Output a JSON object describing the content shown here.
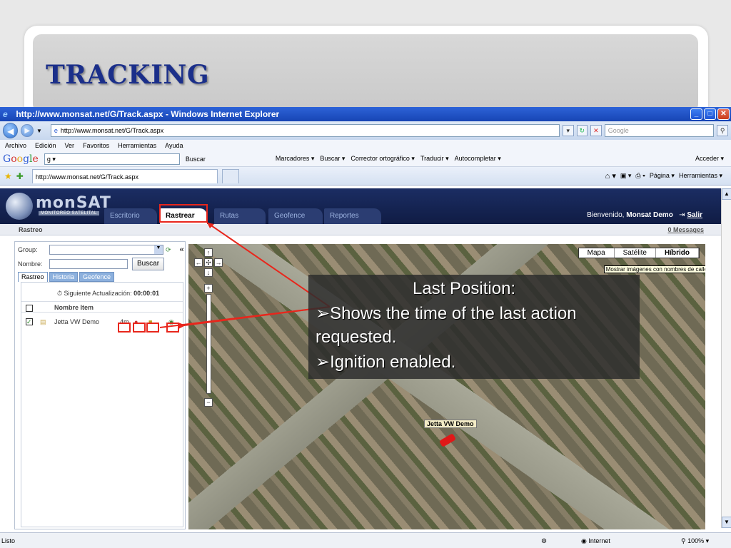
{
  "slide": {
    "title": "TRACKING"
  },
  "browser": {
    "window_title": "http://www.monsat.net/G/Track.aspx - Windows Internet Explorer",
    "url": "http://www.monsat.net/G/Track.aspx",
    "search_placeholder": "Google",
    "menu": [
      "Archivo",
      "Edición",
      "Ver",
      "Favoritos",
      "Herramientas",
      "Ayuda"
    ],
    "google_toolbar": {
      "search_value": "g ▾",
      "buttons": [
        "Buscar",
        "Marcadores ▾",
        "Buscar ▾",
        "Corrector ortográfico ▾",
        "Traducir ▾",
        "Autocompletar ▾",
        "Acceder ▾"
      ]
    },
    "tab_title": "http://www.monsat.net/G/Track.aspx",
    "tab_tools": [
      "Página ▾",
      "Herramientas ▾"
    ],
    "status": "Listo",
    "zone": "Internet",
    "zoom": "100%"
  },
  "app": {
    "logo_text": "monSAT",
    "logo_sub": "MONITOREO SATELITAL",
    "tabs": [
      "Escritorio",
      "Rastrear",
      "Rutas",
      "Geofence",
      "Reportes"
    ],
    "active_tab": "Rastrear",
    "welcome_prefix": "Bienvenido,",
    "welcome_user": "Monsat Demo",
    "logout": "Salir",
    "section_title": "Rastreo",
    "messages": "0 Messages"
  },
  "left_panel": {
    "group_label": "Group:",
    "name_label": "Nombre:",
    "search_button": "Buscar",
    "collapse": "«",
    "tabs": [
      "Rastreo",
      "Historia",
      "Geofence"
    ],
    "update_label": "Siguiente Actualización:",
    "update_value": "00:00:01",
    "column_header": "Nombre Item",
    "items": [
      {
        "name": "Jetta VW Demo",
        "checked": true,
        "last": "4m"
      }
    ]
  },
  "map": {
    "types": [
      "Mapa",
      "Satélite",
      "Híbrido"
    ],
    "active_type": "Híbrido",
    "tooltip": "Mostrar imágenes con nombres de calle",
    "vehicle_label": "Jetta VW Demo"
  },
  "overlay": {
    "title": "Last Position:",
    "lines": [
      "➢Shows the time of the last action",
      "requested.",
      "➢Ignition enabled."
    ]
  },
  "colors": {
    "slide_title": "#1b2f8a",
    "annotation": "#e8261c",
    "app_header": "#1b2d63"
  }
}
